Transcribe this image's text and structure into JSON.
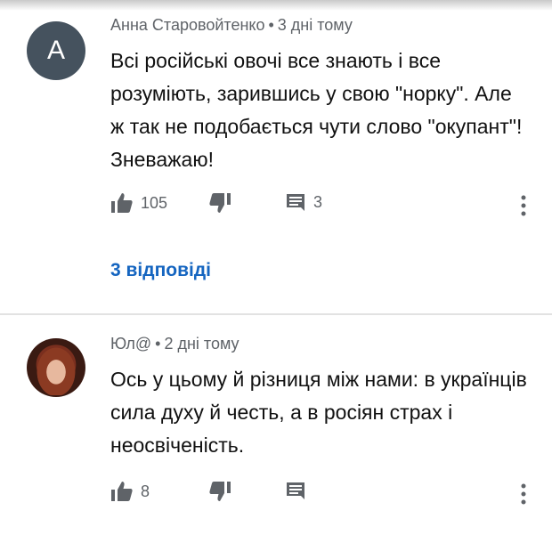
{
  "comments": [
    {
      "avatar_letter": "A",
      "author": "Анна Старовойтенко",
      "time": "3 дні тому",
      "text": "Всі російські овочі все знають і все розуміють, зарившись у свою \"норку\". Але ж так не подобається чути слово \"окупант\"!  Зневажаю!",
      "likes": "105",
      "reply_count": "3",
      "replies_link": "3 відповіді"
    },
    {
      "author": "Юл@",
      "time": "2 дні тому",
      "text": "Ось у цьому й різниця між нами: в українців сила духу й честь, а в росіян страх і неосвіченість.",
      "likes": "8"
    }
  ],
  "separator": "•",
  "icons": {
    "like": "thumb-up-icon",
    "dislike": "thumb-down-icon",
    "reply": "comment-icon",
    "more": "more-vert-icon"
  },
  "colors": {
    "meta": "#5f6368",
    "link": "#1565c0",
    "avatar_bg": "#45525e"
  }
}
